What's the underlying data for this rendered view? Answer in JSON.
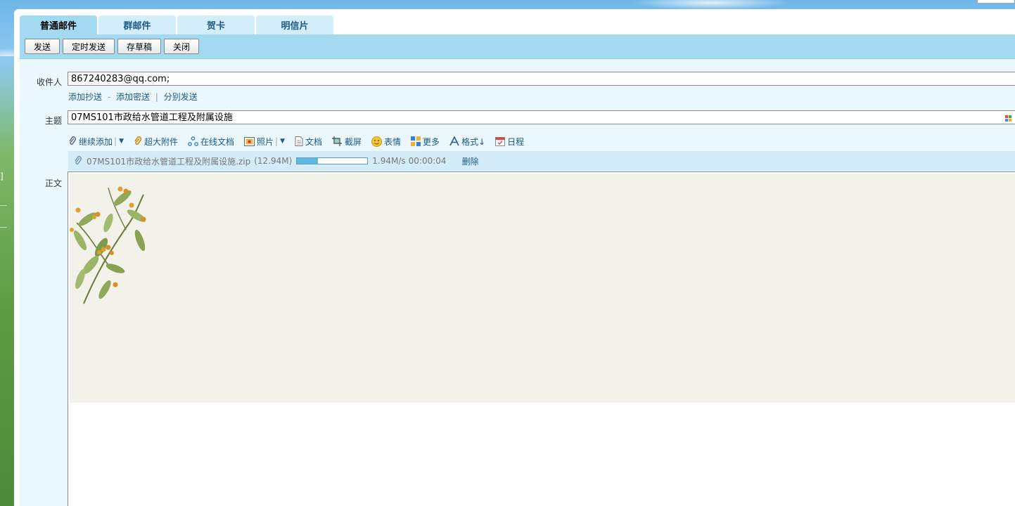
{
  "tabs": [
    {
      "label": "普通邮件",
      "active": true
    },
    {
      "label": "群邮件",
      "active": false
    },
    {
      "label": "贺卡",
      "active": false
    },
    {
      "label": "明信片",
      "active": false
    }
  ],
  "toolbar": {
    "send": "发送",
    "scheduled_send": "定时发送",
    "save_draft": "存草稿",
    "close": "关闭"
  },
  "compose": {
    "to_label": "收件人",
    "to_value": "867240283@qq.com;",
    "add_cc": "添加抄送",
    "dash": "-",
    "add_bcc": "添加密送",
    "pipe": "|",
    "separate_send": "分别发送",
    "subject_label": "主题",
    "subject_value": "07MS101市政给水管道工程及附属设施",
    "body_label": "正文"
  },
  "attach_tools": [
    {
      "label": "继续添加",
      "icon": "paperclip-icon",
      "dropdown": true
    },
    {
      "label": "超大附件",
      "icon": "big-paperclip-icon"
    },
    {
      "label": "在线文档",
      "icon": "share-doc-icon"
    },
    {
      "label": "照片",
      "icon": "photo-icon",
      "dropdown": true
    },
    {
      "label": "文档",
      "icon": "document-icon"
    },
    {
      "label": "截屏",
      "icon": "screenshot-icon"
    },
    {
      "label": "表情",
      "icon": "smiley-icon"
    },
    {
      "label": "更多",
      "icon": "grid-icon"
    },
    {
      "label": "格式↓",
      "icon": "font-format-icon"
    },
    {
      "label": "日程",
      "icon": "calendar-icon"
    }
  ],
  "upload": {
    "filename": "07MS101市政给水管道工程及附属设施.zip",
    "size": "(12.94M)",
    "progress": 0.3,
    "speed": "1.94M/s",
    "eta": "00:00:04",
    "delete_label": "删除"
  },
  "background": {
    "left_glyph": "]"
  },
  "colors": {
    "tab_active": "#a3d9f1",
    "tab_inactive": "#d3eefa",
    "link": "#1a5a86",
    "form_bg": "#eaf7fc",
    "paper_bg": "#f2f1ea"
  }
}
